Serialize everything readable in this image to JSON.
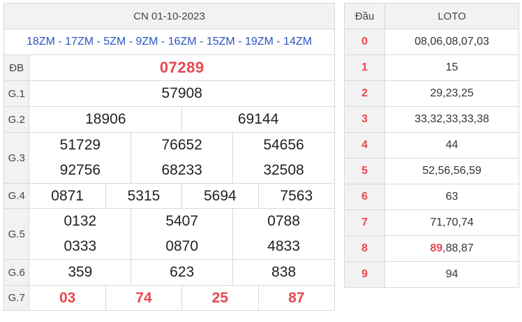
{
  "results": {
    "date": "CN 01-10-2023",
    "codes": "18ZM - 17ZM - 5ZM - 9ZM - 16ZM - 15ZM - 19ZM - 14ZM",
    "rows": {
      "db": {
        "label": "ĐB",
        "values": [
          "07289"
        ]
      },
      "g1": {
        "label": "G.1",
        "values": [
          "57908"
        ]
      },
      "g2": {
        "label": "G.2",
        "values": [
          "18906",
          "69144"
        ]
      },
      "g3": {
        "label": "G.3",
        "values": [
          "51729",
          "76652",
          "54656",
          "92756",
          "68233",
          "32508"
        ]
      },
      "g4": {
        "label": "G.4",
        "values": [
          "0871",
          "5315",
          "5694",
          "7563"
        ]
      },
      "g5": {
        "label": "G.5",
        "values": [
          "0132",
          "5407",
          "0788",
          "0333",
          "0870",
          "4833"
        ]
      },
      "g6": {
        "label": "G.6",
        "values": [
          "359",
          "623",
          "838"
        ]
      },
      "g7": {
        "label": "G.7",
        "values": [
          "03",
          "74",
          "25",
          "87"
        ]
      }
    }
  },
  "loto": {
    "header_dau": "Đầu",
    "header_loto": "LOTO",
    "rows": [
      {
        "dau": "0",
        "highlight": "",
        "rest": "08,06,08,07,03"
      },
      {
        "dau": "1",
        "highlight": "",
        "rest": "15"
      },
      {
        "dau": "2",
        "highlight": "",
        "rest": "29,23,25"
      },
      {
        "dau": "3",
        "highlight": "",
        "rest": "33,32,33,33,38"
      },
      {
        "dau": "4",
        "highlight": "",
        "rest": "44"
      },
      {
        "dau": "5",
        "highlight": "",
        "rest": "52,56,56,59"
      },
      {
        "dau": "6",
        "highlight": "",
        "rest": "63"
      },
      {
        "dau": "7",
        "highlight": "",
        "rest": "71,70,74"
      },
      {
        "dau": "8",
        "highlight": "89",
        "rest": ",88,87"
      },
      {
        "dau": "9",
        "highlight": "",
        "rest": "94"
      }
    ]
  },
  "colors": {
    "accent_red": "#e8474f",
    "code_blue": "#2a54c4",
    "header_bg": "#f2f2f2",
    "border": "#d9d9d9"
  }
}
